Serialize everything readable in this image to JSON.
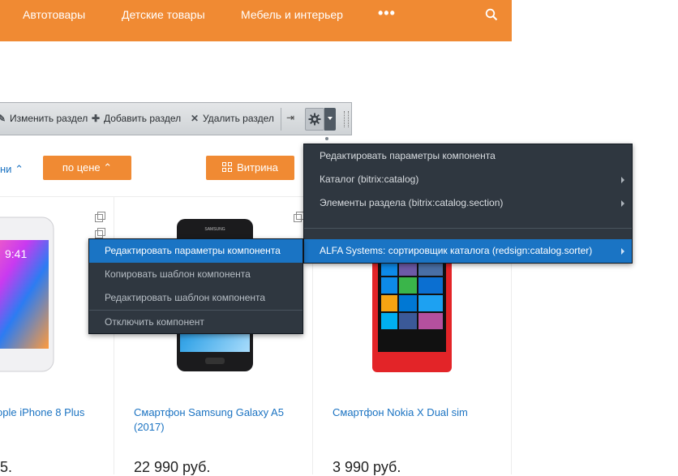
{
  "topnav": {
    "items": [
      "Автотовары",
      "Детские товары",
      "Мебель и интерьер"
    ],
    "more": "•••"
  },
  "admin_bar": {
    "edit_section": "Изменить раздел",
    "add_section": "Добавить раздел",
    "delete_section": "Удалить раздел"
  },
  "sort": {
    "link_text": "ни",
    "price_label": "по цене",
    "view_label": "Витрина"
  },
  "products": [
    {
      "name": "ople iPhone 8 Plus",
      "price": "5."
    },
    {
      "name": "Смартфон Samsung Galaxy A5 (2017)",
      "price": "22 990 руб."
    },
    {
      "name": "Смартфон Nokia X Dual sim",
      "price": "3 990 руб."
    }
  ],
  "component_menu": {
    "items": [
      "Редактировать параметры компонента",
      "Копировать шаблон компонента",
      "Редактировать шаблон компонента",
      "Отключить компонент"
    ]
  },
  "settings_menu": {
    "items": [
      "Редактировать параметры компонента",
      "Каталог (bitrix:catalog)",
      "Элементы раздела (bitrix:catalog.section)",
      "ALFA Systems: сортировщик каталога (redsign:catalog.sorter)"
    ]
  },
  "phone_screen": {
    "time": "9:41"
  },
  "colors": {
    "accent": "#f08a33",
    "link": "#1b73c2",
    "menu_bg": "#2f3740",
    "menu_active": "#1a74c4"
  }
}
